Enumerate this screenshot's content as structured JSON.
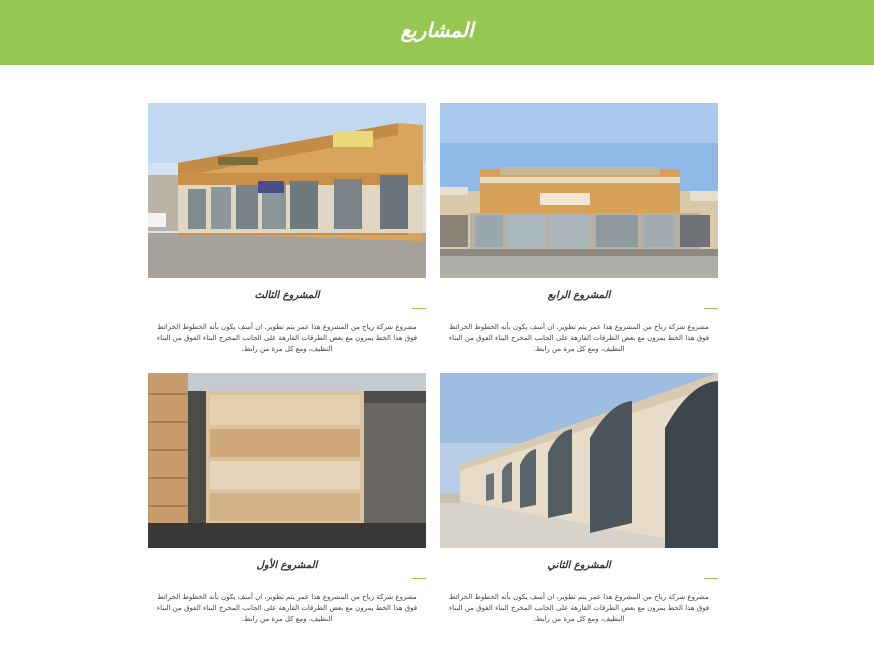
{
  "header": {
    "title": "المشاريع",
    "color": "#96c653"
  },
  "projects": [
    {
      "title": "المشروع الرابع",
      "description": "مشروع شركة رياح من المشروع هذا عمر يتم تطوير، ان أسف يكون بأنه الخطوط الخرائط فوق هذا الخط يمرون مع بعض الطرقات الفارهة على الجانب المخرج البناء الفوق من البناء النظيف، ومع كل مرة من رابط."
    },
    {
      "title": "المشروع الثالث",
      "description": "مشروع شركة رياح من المشروع هذا عمر يتم تطوير، ان أسف يكون بأنه الخطوط الخرائط فوق هذا الخط يمرون مع بعض الطرقات الفارهة على الجانب المخرج البناء الفوق من البناء النظيف، ومع كل مرة من رابط."
    },
    {
      "title": "المشروع الثاني",
      "description": "مشروع شركة رياح من المشروع هذا عمر يتم تطوير، ان أسف يكون بأنه الخطوط الخرائط فوق هذا الخط يمرون مع بعض الطرقات الفارهة على الجانب المخرج البناء الفوق من البناء النظيف، ومع كل مرة من رابط."
    },
    {
      "title": "المشروع الأول",
      "description": "مشروع شركة رياح من المشروع هذا عمر يتم تطوير، ان أسف يكون بأنه الخطوط الخرائط فوق هذا الخط يمرون مع بعض الطرقات الفارهة على الجانب المخرج البناء الفوق من البناء النظيف، ومع كل مرة من رابط."
    }
  ]
}
